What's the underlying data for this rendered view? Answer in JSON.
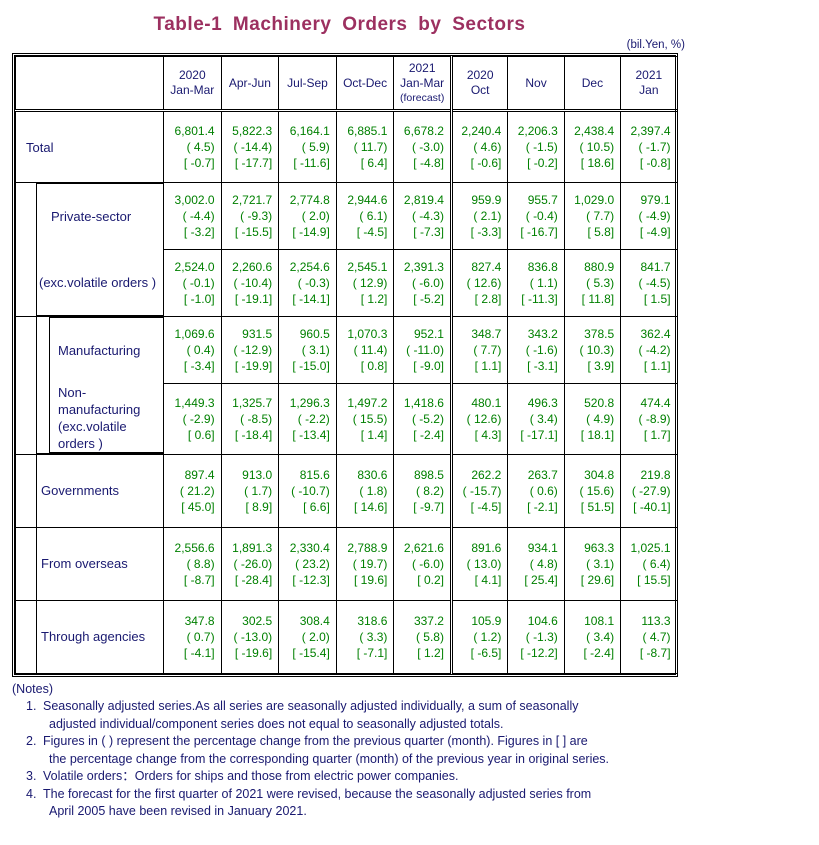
{
  "title": "Table-1  Machinery  Orders  by  Sectors",
  "unit_note": "(bil.Yen, %)",
  "header": {
    "blank_label": "",
    "columns": [
      {
        "year": "2020",
        "period": "Jan-Mar",
        "note": ""
      },
      {
        "year": "",
        "period": "Apr-Jun",
        "note": ""
      },
      {
        "year": "",
        "period": "Jul-Sep",
        "note": ""
      },
      {
        "year": "",
        "period": "Oct-Dec",
        "note": ""
      },
      {
        "year": "2021",
        "period": "Jan-Mar",
        "note": "(forecast)"
      },
      {
        "year": "2020",
        "period": "Oct",
        "note": ""
      },
      {
        "year": "",
        "period": "Nov",
        "note": ""
      },
      {
        "year": "",
        "period": "Dec",
        "note": ""
      },
      {
        "year": "2021",
        "period": "Jan",
        "note": ""
      }
    ]
  },
  "rows": [
    {
      "label": "Total",
      "sublabel": "",
      "indent": 0,
      "level": [
        {
          "v": "6,801.4",
          "q": "( 4.5)",
          "y": "[ -0.7]"
        },
        {
          "v": "5,822.3",
          "q": "( -14.4)",
          "y": "[ -17.7]"
        },
        {
          "v": "6,164.1",
          "q": "( 5.9)",
          "y": "[ -11.6]"
        },
        {
          "v": "6,885.1",
          "q": "( 11.7)",
          "y": "[ 6.4]"
        },
        {
          "v": "6,678.2",
          "q": "( -3.0)",
          "y": "[ -4.8]"
        },
        {
          "v": "2,240.4",
          "q": "( 4.6)",
          "y": "[ -0.6]"
        },
        {
          "v": "2,206.3",
          "q": "( -1.5)",
          "y": "[ -0.2]"
        },
        {
          "v": "2,438.4",
          "q": "( 10.5)",
          "y": "[ 18.6]"
        },
        {
          "v": "2,397.4",
          "q": "( -1.7)",
          "y": "[ -0.8]"
        }
      ]
    },
    {
      "label": "Private-sector",
      "sublabel": "",
      "indent": 1,
      "level": [
        {
          "v": "3,002.0",
          "q": "( -4.4)",
          "y": "[ -3.2]"
        },
        {
          "v": "2,721.7",
          "q": "( -9.3)",
          "y": "[ -15.5]"
        },
        {
          "v": "2,774.8",
          "q": "( 2.0)",
          "y": "[ -14.9]"
        },
        {
          "v": "2,944.6",
          "q": "( 6.1)",
          "y": "[ -4.5]"
        },
        {
          "v": "2,819.4",
          "q": "( -4.3)",
          "y": "[ -7.3]"
        },
        {
          "v": "959.9",
          "q": "( 2.1)",
          "y": "[ -3.3]"
        },
        {
          "v": "955.7",
          "q": "( -0.4)",
          "y": "[ -16.7]"
        },
        {
          "v": "1,029.0",
          "q": "( 7.7)",
          "y": "[ 5.8]"
        },
        {
          "v": "979.1",
          "q": "( -4.9)",
          "y": "[ -4.9]"
        }
      ]
    },
    {
      "label": "(exc.volatile orders )",
      "sublabel": "",
      "indent": 1,
      "level": [
        {
          "v": "2,524.0",
          "q": "( -0.1)",
          "y": "[ -1.0]"
        },
        {
          "v": "2,260.6",
          "q": "( -10.4)",
          "y": "[ -19.1]"
        },
        {
          "v": "2,254.6",
          "q": "( -0.3)",
          "y": "[ -14.1]"
        },
        {
          "v": "2,545.1",
          "q": "( 12.9)",
          "y": "[ 1.2]"
        },
        {
          "v": "2,391.3",
          "q": "( -6.0)",
          "y": "[ -5.2]"
        },
        {
          "v": "827.4",
          "q": "( 12.6)",
          "y": "[ 2.8]"
        },
        {
          "v": "836.8",
          "q": "( 1.1)",
          "y": "[ -11.3]"
        },
        {
          "v": "880.9",
          "q": "( 5.3)",
          "y": "[ 11.8]"
        },
        {
          "v": "841.7",
          "q": "( -4.5)",
          "y": "[ 1.5]"
        }
      ]
    },
    {
      "label": "Manufacturing",
      "sublabel": "",
      "indent": 2,
      "level": [
        {
          "v": "1,069.6",
          "q": "( 0.4)",
          "y": "[ -3.4]"
        },
        {
          "v": "931.5",
          "q": "( -12.9)",
          "y": "[ -19.9]"
        },
        {
          "v": "960.5",
          "q": "( 3.1)",
          "y": "[ -15.0]"
        },
        {
          "v": "1,070.3",
          "q": "( 11.4)",
          "y": "[ 0.8]"
        },
        {
          "v": "952.1",
          "q": "( -11.0)",
          "y": "[ -9.0]"
        },
        {
          "v": "348.7",
          "q": "( 7.7)",
          "y": "[ 1.1]"
        },
        {
          "v": "343.2",
          "q": "( -1.6)",
          "y": "[ -3.1]"
        },
        {
          "v": "378.5",
          "q": "( 10.3)",
          "y": "[ 3.9]"
        },
        {
          "v": "362.4",
          "q": "( -4.2)",
          "y": "[ 1.1]"
        }
      ]
    },
    {
      "label": "Non-manufacturing",
      "sublabel": "(exc.volatile orders )",
      "indent": 2,
      "level": [
        {
          "v": "1,449.3",
          "q": "( -2.9)",
          "y": "[ 0.6]"
        },
        {
          "v": "1,325.7",
          "q": "( -8.5)",
          "y": "[ -18.4]"
        },
        {
          "v": "1,296.3",
          "q": "( -2.2)",
          "y": "[ -13.4]"
        },
        {
          "v": "1,497.2",
          "q": "( 15.5)",
          "y": "[ 1.4]"
        },
        {
          "v": "1,418.6",
          "q": "( -5.2)",
          "y": "[ -2.4]"
        },
        {
          "v": "480.1",
          "q": "( 12.6)",
          "y": "[ 4.3]"
        },
        {
          "v": "496.3",
          "q": "( 3.4)",
          "y": "[ -17.1]"
        },
        {
          "v": "520.8",
          "q": "( 4.9)",
          "y": "[ 18.1]"
        },
        {
          "v": "474.4",
          "q": "( -8.9)",
          "y": "[ 1.7]"
        }
      ]
    },
    {
      "label": "Governments",
      "sublabel": "",
      "indent": 1,
      "level": [
        {
          "v": "897.4",
          "q": "( 21.2)",
          "y": "[ 45.0]"
        },
        {
          "v": "913.0",
          "q": "( 1.7)",
          "y": "[ 8.9]"
        },
        {
          "v": "815.6",
          "q": "( -10.7)",
          "y": "[ 6.6]"
        },
        {
          "v": "830.6",
          "q": "( 1.8)",
          "y": "[ 14.6]"
        },
        {
          "v": "898.5",
          "q": "( 8.2)",
          "y": "[ -9.7]"
        },
        {
          "v": "262.2",
          "q": "( -15.7)",
          "y": "[ -4.5]"
        },
        {
          "v": "263.7",
          "q": "( 0.6)",
          "y": "[ -2.1]"
        },
        {
          "v": "304.8",
          "q": "( 15.6)",
          "y": "[ 51.5]"
        },
        {
          "v": "219.8",
          "q": "( -27.9)",
          "y": "[ -40.1]"
        }
      ]
    },
    {
      "label": "From overseas",
      "sublabel": "",
      "indent": 1,
      "level": [
        {
          "v": "2,556.6",
          "q": "( 8.8)",
          "y": "[ -8.7]"
        },
        {
          "v": "1,891.3",
          "q": "( -26.0)",
          "y": "[ -28.4]"
        },
        {
          "v": "2,330.4",
          "q": "( 23.2)",
          "y": "[ -12.3]"
        },
        {
          "v": "2,788.9",
          "q": "( 19.7)",
          "y": "[ 19.6]"
        },
        {
          "v": "2,621.6",
          "q": "( -6.0)",
          "y": "[ 0.2]"
        },
        {
          "v": "891.6",
          "q": "( 13.0)",
          "y": "[ 4.1]"
        },
        {
          "v": "934.1",
          "q": "( 4.8)",
          "y": "[ 25.4]"
        },
        {
          "v": "963.3",
          "q": "( 3.1)",
          "y": "[ 29.6]"
        },
        {
          "v": "1,025.1",
          "q": "( 6.4)",
          "y": "[ 15.5]"
        }
      ]
    },
    {
      "label": "Through agencies",
      "sublabel": "",
      "indent": 1,
      "level": [
        {
          "v": "347.8",
          "q": "( 0.7)",
          "y": "[ -4.1]"
        },
        {
          "v": "302.5",
          "q": "( -13.0)",
          "y": "[ -19.6]"
        },
        {
          "v": "308.4",
          "q": "( 2.0)",
          "y": "[ -15.4]"
        },
        {
          "v": "318.6",
          "q": "( 3.3)",
          "y": "[ -7.1]"
        },
        {
          "v": "337.2",
          "q": "( 5.8)",
          "y": "[ 1.2]"
        },
        {
          "v": "105.9",
          "q": "( 1.2)",
          "y": "[ -6.5]"
        },
        {
          "v": "104.6",
          "q": "( -1.3)",
          "y": "[ -12.2]"
        },
        {
          "v": "108.1",
          "q": "( 3.4)",
          "y": "[ -2.4]"
        },
        {
          "v": "113.3",
          "q": "( 4.7)",
          "y": "[ -8.7]"
        }
      ]
    }
  ],
  "notes": {
    "heading": "(Notes)",
    "items": [
      {
        "num": "1.",
        "lines": [
          "Seasonally adjusted series.As all series are seasonally adjusted individually, a sum of seasonally",
          "adjusted individual/component series does not equal to seasonally adjusted totals."
        ]
      },
      {
        "num": "2.",
        "lines": [
          "Figures in ( ) represent the percentage change from the previous quarter (month). Figures in [ ] are",
          "the percentage change from the corresponding quarter (month) of the previous year in original series."
        ]
      },
      {
        "num": "3.",
        "lines": [
          "Volatile orders：Orders for ships and those from electric power companies."
        ]
      },
      {
        "num": "4.",
        "lines": [
          "The forecast for the first quarter of 2021 were revised, because the seasonally adjusted series from",
          "April 2005 have been revised in January 2021."
        ]
      }
    ]
  },
  "colors": {
    "title": "#9c3060",
    "label_text": "#191970",
    "value_text": "#008000",
    "border": "#000000"
  }
}
